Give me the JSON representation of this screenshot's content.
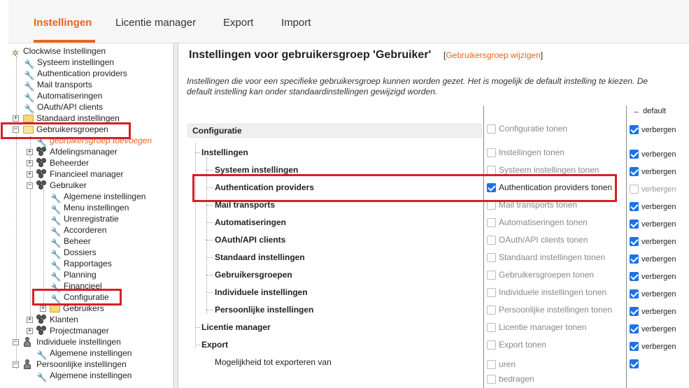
{
  "tabs": [
    {
      "label": "Instellingen",
      "active": true
    },
    {
      "label": "Licentie manager",
      "active": false
    },
    {
      "label": "Export",
      "active": false
    },
    {
      "label": "Import",
      "active": false
    }
  ],
  "sidebar": {
    "root": "Clockwise Instellingen",
    "items": [
      "Systeem instellingen",
      "Authentication providers",
      "Mail transports",
      "Automatiseringen",
      "OAuth/API clients",
      "Standaard instellingen",
      "Gebruikersgroepen",
      "gebruikersgroep toevoegen",
      "Afdelingsmanager",
      "Beheerder",
      "Financieel manager",
      "Gebruiker",
      "Algemene instellingen",
      "Menu instellingen",
      "Urenregistratie",
      "Accorderen",
      "Beheer",
      "Dossiers",
      "Rapportages",
      "Planning",
      "Financieel",
      "Configuratie",
      "Gebruikers",
      "Klanten",
      "Projectmanager",
      "Individuele instellingen",
      "Algemene instellingen",
      "Persoonlijke instellingen",
      "Algemene instellingen"
    ]
  },
  "main": {
    "title": "Instellingen voor gebruikersgroep 'Gebruiker'",
    "change_link_open": "[",
    "change_link": "Gebruikersgroep wijzigen",
    "change_link_close": "]",
    "description": "Instellingen die voor een specifieke gebruikersgroep kunnen worden gezet. Het is mogelijk de default instelling te kiezen. De default instelling kan onder standaardinstellingen gewijzigd worden.",
    "default_header": "default",
    "default_arrow": "←",
    "section": "Configuratie",
    "default_label": "verbergen",
    "rows": [
      {
        "label": "Instellingen",
        "toggle": "Instellingen tonen",
        "checked": false,
        "default_checked": true
      },
      {
        "label": "Systeem instellingen",
        "toggle": "Systeem instellingen tonen",
        "checked": false,
        "default_checked": true
      },
      {
        "label": "Authentication providers",
        "toggle": "Authentication providers tonen",
        "checked": true,
        "default_checked": false
      },
      {
        "label": "Mail transports",
        "toggle": "Mail transports tonen",
        "checked": false,
        "default_checked": true
      },
      {
        "label": "Automatiseringen",
        "toggle": "Automatiseringen tonen",
        "checked": false,
        "default_checked": true
      },
      {
        "label": "OAuth/API clients",
        "toggle": "OAuth/API clients tonen",
        "checked": false,
        "default_checked": true
      },
      {
        "label": "Standaard instellingen",
        "toggle": "Standaard instellingen tonen",
        "checked": false,
        "default_checked": true
      },
      {
        "label": "Gebruikersgroepen",
        "toggle": "Gebruikersgroepen tonen",
        "checked": false,
        "default_checked": true
      },
      {
        "label": "Individuele instellingen",
        "toggle": "Individuele instellingen tonen",
        "checked": false,
        "default_checked": true
      },
      {
        "label": "Persoonlijke instellingen",
        "toggle": "Persoonlijke instellingen tonen",
        "checked": false,
        "default_checked": true
      },
      {
        "label": "Licentie manager",
        "toggle": "Licentie manager tonen",
        "checked": false,
        "default_checked": true
      },
      {
        "label": "Export",
        "toggle": "Export tonen",
        "checked": false,
        "default_checked": true
      }
    ],
    "section_toggle": "Configuratie tonen",
    "export_sub_label": "Mogelijkheid tot exporteren van",
    "export_options": [
      "uren",
      "bedragen"
    ]
  },
  "colors": {
    "accent": "#e8641e",
    "checkbox": "#1a73e8",
    "highlight": "#d42027"
  }
}
